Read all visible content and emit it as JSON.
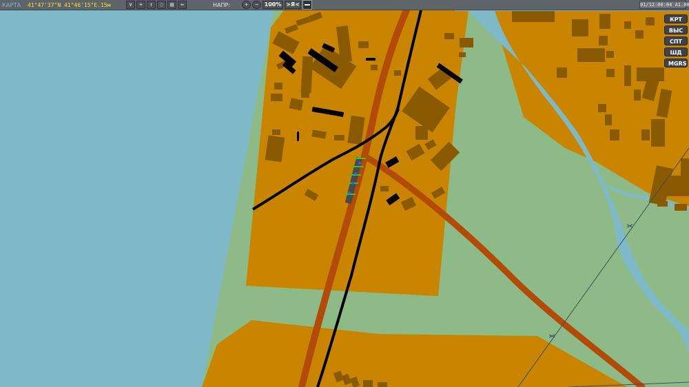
{
  "toolbar": {
    "title": "КАРТА",
    "coordinates": "41°47'37\"N 41°46'15\"E.15м",
    "heading_label": "НАПР:",
    "zoom_percent": "100%",
    "center_button": ">Я<",
    "clock": "01/12:00:04 A1.00P"
  },
  "tools": [
    {
      "name": "measure-tool",
      "icon": "angle-icon",
      "glyph": "∨"
    },
    {
      "name": "pin-tool",
      "icon": "pin-icon",
      "glyph": "⌖"
    },
    {
      "name": "unit-tool",
      "icon": "unit-icon",
      "glyph": "↑"
    },
    {
      "name": "marker-tool",
      "icon": "marker-icon",
      "glyph": "◌"
    },
    {
      "name": "label-tool",
      "icon": "label-icon",
      "glyph": "▤"
    },
    {
      "name": "ruler-tool",
      "icon": "ruler-icon",
      "glyph": "↔"
    }
  ],
  "layers": {
    "items": [
      "КРТ",
      "ВЫС",
      "СПТ",
      "ШД",
      "MGRS"
    ]
  },
  "map": {
    "water_color": "#7fb9c8",
    "urban_color": "#c98500",
    "field_color": "#8dba86",
    "road_color": "#b24a08",
    "rail_color": "#000000",
    "building_color": "#8a5a00",
    "bridge_color": "#32c832"
  }
}
